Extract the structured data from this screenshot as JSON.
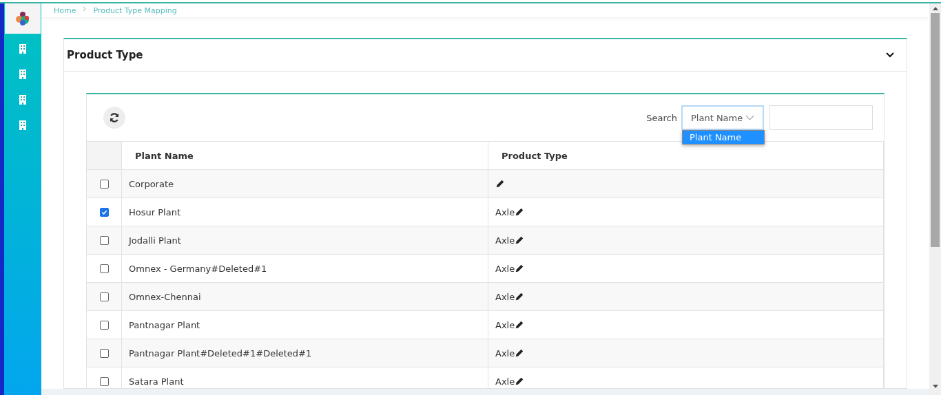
{
  "breadcrumb": [
    "Home",
    "Product Type Mapping"
  ],
  "sidebar": {
    "items": [
      {
        "kind": "building"
      },
      {
        "kind": "building"
      },
      {
        "kind": "building"
      },
      {
        "kind": "building"
      }
    ]
  },
  "card": {
    "title": "Product Type",
    "expanded": true
  },
  "toolbar": {
    "search_label": "Search",
    "select": {
      "value": "Plant Name",
      "expanded": true,
      "options": [
        {
          "label": "Plant Name",
          "selected": true
        }
      ]
    }
  },
  "table": {
    "columns": [
      "Plant Name",
      "Product Type"
    ],
    "rows": [
      {
        "name": "Corporate",
        "checked": false
      },
      {
        "name": "Hosur Plant",
        "checked": true,
        "product_type": "Axle"
      },
      {
        "name": "Jodalli Plant",
        "checked": false,
        "product_type": "Axle"
      },
      {
        "name": "Omnex - Germany#Deleted#1",
        "checked": false,
        "product_type": "Axle"
      },
      {
        "name": "Omnex-Chennai",
        "checked": false,
        "product_type": "Axle"
      },
      {
        "name": "Pantnagar Plant",
        "checked": false,
        "product_type": "Axle"
      },
      {
        "name": "Pantnagar Plant#Deleted#1#Deleted#1",
        "checked": false,
        "product_type": "Axle"
      },
      {
        "name": "Satara Plant",
        "checked": false,
        "product_type": "Axle"
      }
    ]
  }
}
